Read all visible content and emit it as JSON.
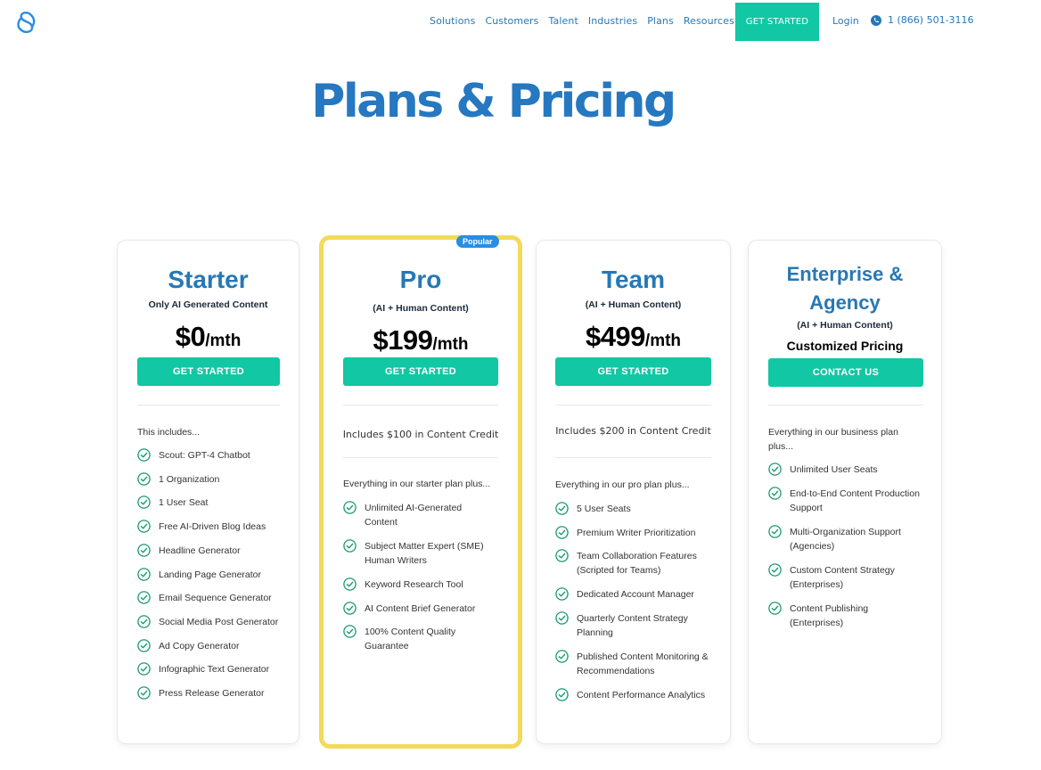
{
  "header": {
    "logo": "brand-logo",
    "nav": [
      "Solutions",
      "Customers",
      "Talent",
      "Industries",
      "Plans",
      "Resources"
    ],
    "cta": "GET STARTED",
    "login": "Login",
    "phone": "1 (866) 501-3116",
    "accent": "#2678b6",
    "cta_color": "#12c7a3"
  },
  "page": {
    "title": "Plans & Pricing"
  },
  "plans": [
    {
      "name": "Starter",
      "subtitle": "Only AI Generated Content",
      "price": "$0",
      "unit": "/mth",
      "button": "GET STARTED",
      "intro": "This includes...",
      "features": [
        "Scout: GPT-4 Chatbot",
        "1 Organization",
        "1 User Seat",
        "Free AI-Driven Blog Ideas",
        "Headline Generator",
        "Landing Page Generator",
        "Email Sequence Generator",
        "Social Media Post Generator",
        "Ad Copy Generator",
        "Infographic Text Generator",
        "Press Release Generator"
      ]
    },
    {
      "name": "Pro",
      "badge": "Popular",
      "subtitle": "(AI + Human Content)",
      "price": "$199",
      "unit": "/mth",
      "button": "GET STARTED",
      "credit": "Includes $100 in Content Credit",
      "intro": "Everything in our starter plan plus...",
      "features": [
        [
          "Unlimited AI-Generated",
          "Content"
        ],
        [
          "Subject Matter Expert (SME)",
          "Human Writers"
        ],
        [
          "Keyword Research Tool"
        ],
        [
          "AI Content Brief Generator"
        ],
        [
          "100% Content Quality",
          "Guarantee"
        ]
      ]
    },
    {
      "name": "Team",
      "subtitle": "(AI + Human Content)",
      "price": "$499",
      "unit": "/mth",
      "button": "GET STARTED",
      "credit": "Includes $200 in Content Credit",
      "intro": "Everything in our pro plan plus...",
      "features": [
        [
          "5 User Seats"
        ],
        [
          "Premium Writer Prioritization"
        ],
        [
          "Team Collaboration Features",
          "(Scripted for Teams)"
        ],
        [
          "Dedicated Account Manager"
        ],
        [
          "Quarterly Content Strategy",
          "Planning"
        ],
        [
          "Published Content Monitoring &",
          "Recommendations"
        ],
        [
          "Content Performance Analytics"
        ]
      ]
    },
    {
      "name_lines": [
        "Enterprise &",
        "Agency"
      ],
      "subtitle": "(AI + Human Content)",
      "price_text": "Customized Pricing",
      "button": "CONTACT US",
      "intro_lines": [
        "Everything in our business plan",
        "plus..."
      ],
      "features": [
        [
          "Unlimited User Seats"
        ],
        [
          "End-to-End Content Production",
          "Support"
        ],
        [
          "Multi-Organization Support",
          "(Agencies)"
        ],
        [
          "Custom Content Strategy",
          "(Enterprises)"
        ],
        [
          "Content Publishing",
          "(Enterprises)"
        ]
      ]
    }
  ]
}
